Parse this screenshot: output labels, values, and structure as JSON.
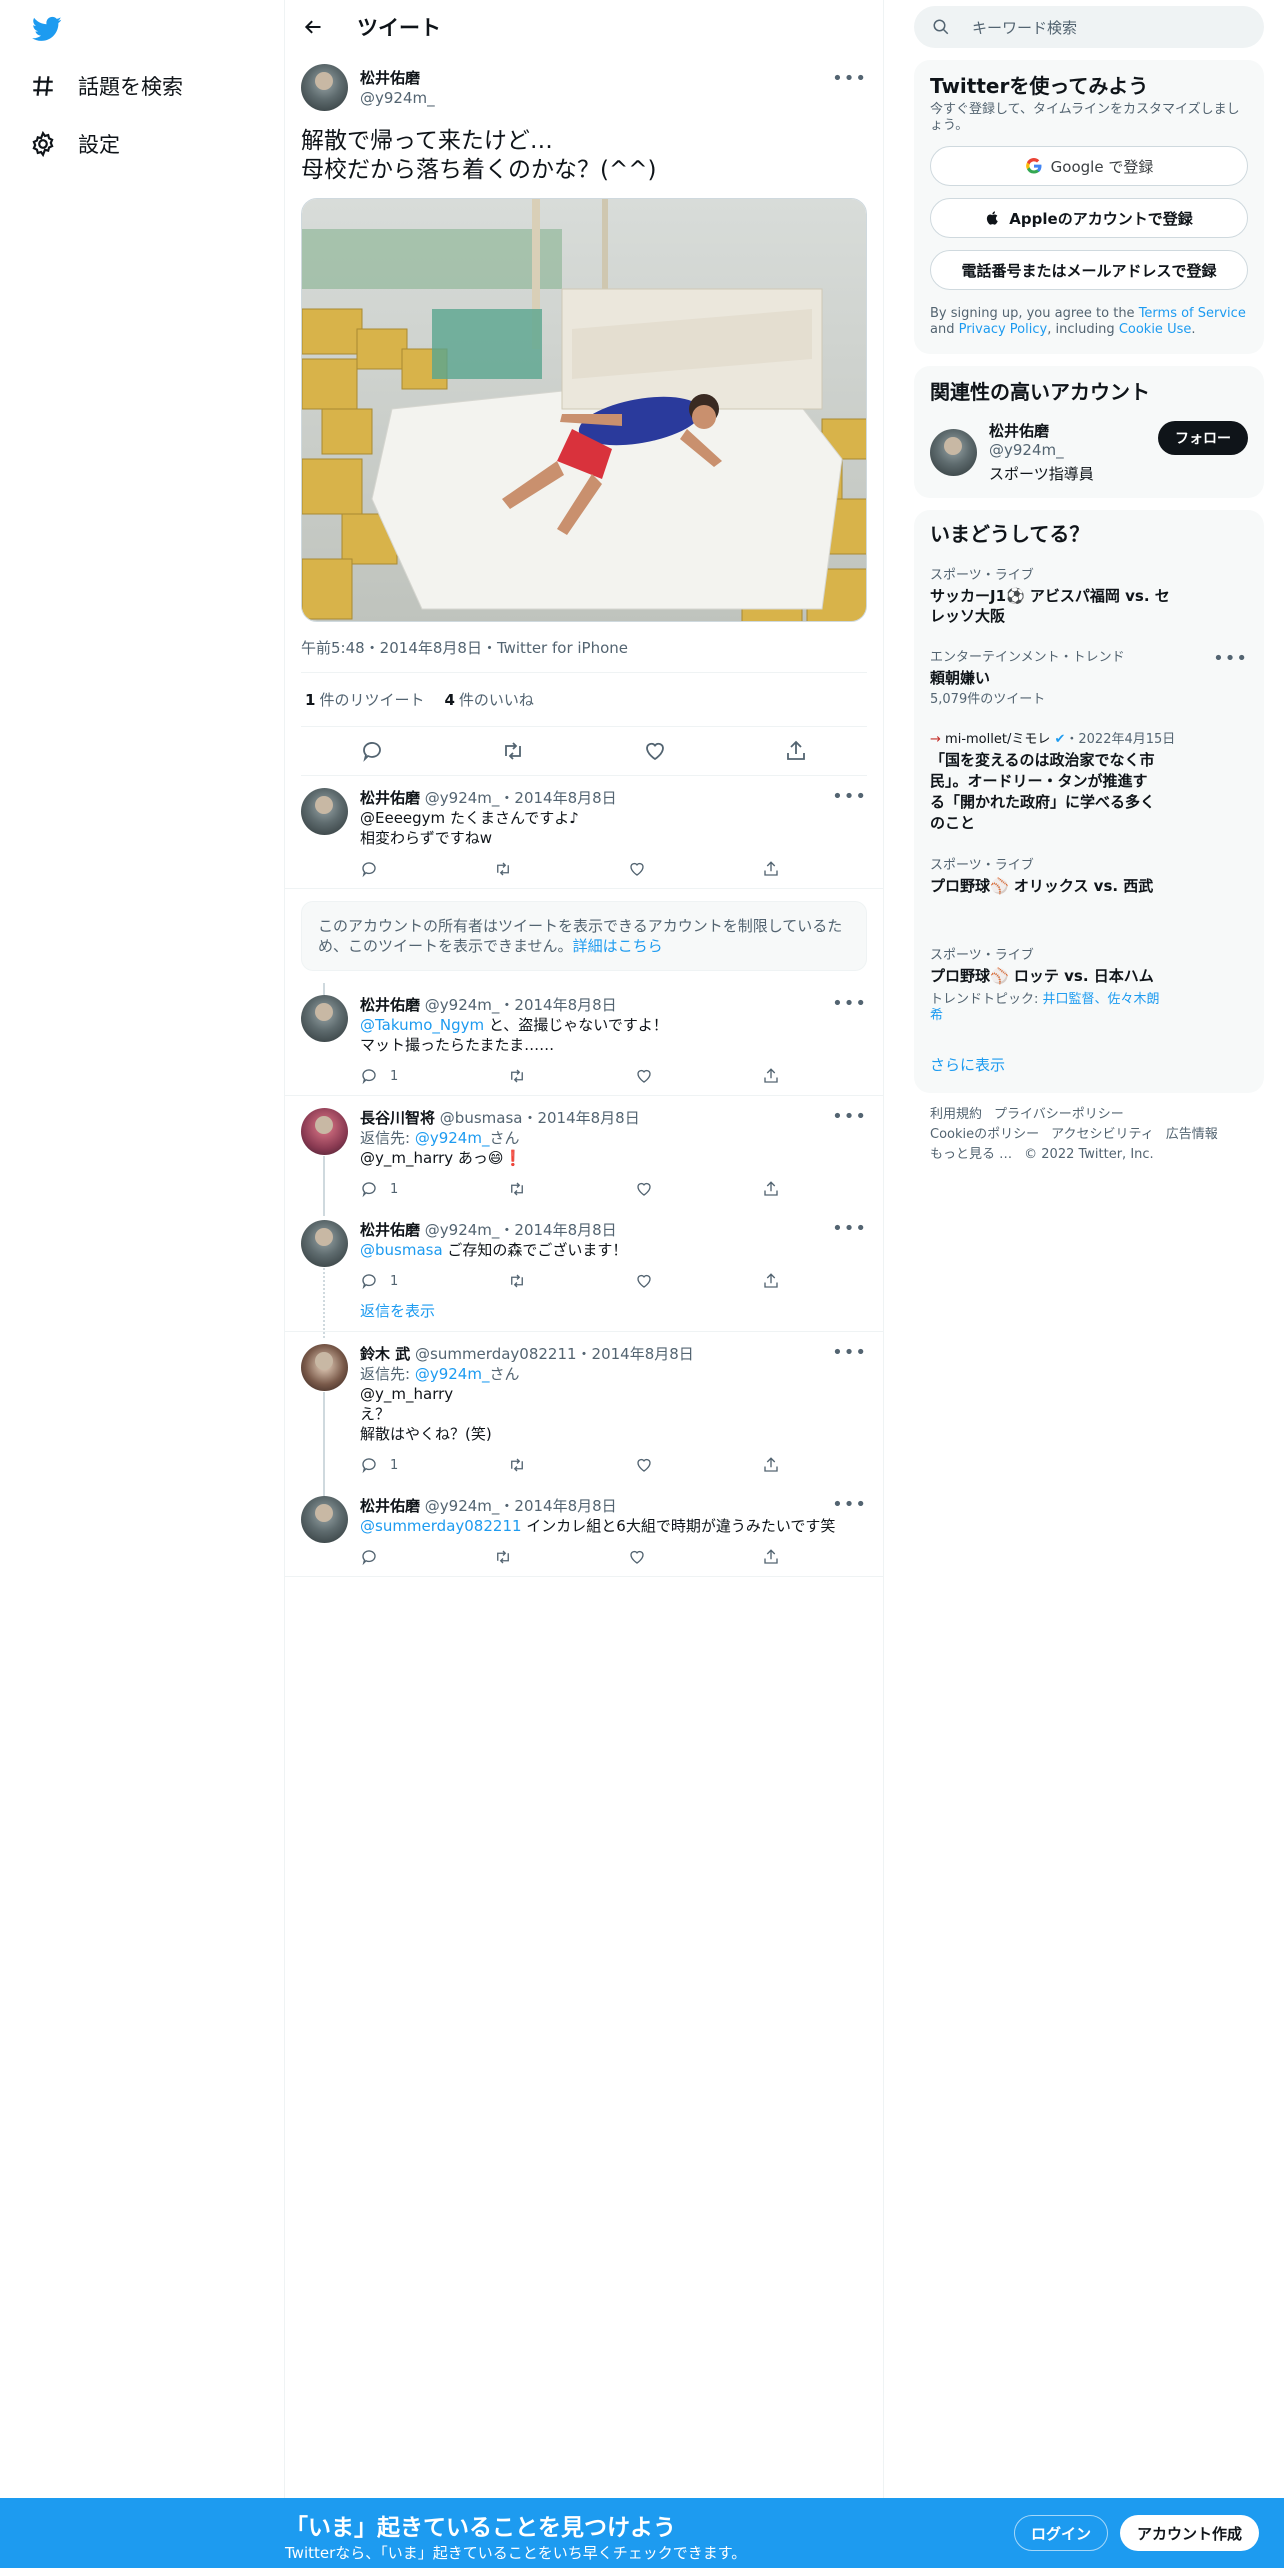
{
  "nav": {
    "explore": "話題を検索",
    "settings": "設定"
  },
  "header": {
    "title": "ツイート"
  },
  "focal": {
    "name": "松井佑磨",
    "handle": "@y924m_",
    "text": "解散で帰って来たけど…\n母校だから落ち着くのかな？(^^)",
    "meta": "午前5:48・2014年8月8日・Twitter for iPhone",
    "retweets_count": "1",
    "retweets_label": "件のリツイート",
    "likes_count": "4",
    "likes_label": "件のいいね"
  },
  "replies": [
    {
      "name": "松井佑磨",
      "handle": "@y924m_",
      "date": "・2014年8月8日",
      "text": "@Eeeegym たくまさんですよ♪\n相変わらずですねw",
      "count": ""
    },
    {
      "name": "松井佑磨",
      "handle": "@y924m_",
      "date": "・2014年8月8日",
      "mention": "@Takumo_Ngym",
      "text": " と、盗撮じゃないですよ！\nマット撮ったらたまたま……",
      "count": "1"
    },
    {
      "name": "長谷川智将",
      "handle": "@busmasa",
      "date": "・2014年8月8日",
      "reply_to_prefix": "返信先: ",
      "reply_to": "@y924m_",
      "reply_to_suffix": "さん",
      "text": "@y_m_harry あっ😄❗",
      "count": "1"
    },
    {
      "name": "松井佑磨",
      "handle": "@y924m_",
      "date": "・2014年8月8日",
      "mention": "@busmasa",
      "text": " ご存知の森でございます！",
      "count": "1"
    },
    {
      "name": "鈴木 武",
      "handle": "@summerday082211",
      "date": "・2014年8月8日",
      "reply_to_prefix": "返信先: ",
      "reply_to": "@y924m_",
      "reply_to_suffix": "さん",
      "text": "@y_m_harry\nえ？\n解散はやくね？(笑)",
      "count": "1"
    },
    {
      "name": "松井佑磨",
      "handle": "@y924m_",
      "date": "・2014年8月8日",
      "mention": "@summerday082211",
      "text": " インカレ組と6大組で時期が違うみたいです笑",
      "count": ""
    }
  ],
  "restricted": {
    "text": "このアカウントの所有者はツイートを表示できるアカウントを制限しているため、このツイートを表示できません。",
    "link": "詳細はこちら"
  },
  "show_replies": "返信を表示",
  "search": {
    "placeholder": "キーワード検索"
  },
  "signup": {
    "title": "Twitterを使ってみよう",
    "subtitle": "今すぐ登録して、タイムラインをカスタマイズしましょう。",
    "google": "Google で登録",
    "apple": "Appleのアカウントで登録",
    "phone": "電話番号またはメールアドレスで登録",
    "legal_1": "By signing up, you agree to the ",
    "tos": "Terms of Service",
    "legal_2": " and ",
    "privacy": "Privacy Policy",
    "legal_3": ", including ",
    "cookie": "Cookie Use",
    "legal_4": "."
  },
  "related": {
    "title": "関連性の高いアカウント",
    "name": "松井佑磨",
    "handle": "@y924m_",
    "bio": "スポーツ指導員",
    "follow": "フォロー"
  },
  "trends": {
    "title": "いまどうしてる？",
    "items": [
      {
        "category": "スポーツ・ライブ",
        "name": "サッカーJ1⚽️ アビスパ福岡 vs. セレッソ大阪"
      },
      {
        "category": "エンターテインメント・トレンド",
        "name": "頼朝嫌い",
        "count": "5,079件のツイート"
      },
      {
        "source": "mi-mollet/ミモレ",
        "date": "・2022年4月15日",
        "name": "「国を変えるのは政治家でなく市民」。オードリー・タンが推進する「開かれた政府」に学べる多くのこと"
      },
      {
        "category": "スポーツ・ライブ",
        "name": "プロ野球⚾ オリックス vs. 西武"
      },
      {
        "category": "スポーツ・ライブ",
        "name": "プロ野球⚾ ロッテ vs. 日本ハム",
        "topic_prefix": "トレンドトピック: ",
        "topic": "井口監督、佐々木朗希"
      }
    ],
    "more": "さらに表示"
  },
  "footer": {
    "links": [
      "利用規約",
      "プライバシーポリシー",
      "Cookieのポリシー",
      "アクセシビリティ",
      "広告情報",
      "もっと見る …"
    ],
    "copyright": "© 2022 Twitter, Inc."
  },
  "bottombar": {
    "title": "「いま」起きていることを見つけよう",
    "subtitle": "Twitterなら、「いま」起きていることをいち早くチェックできます。",
    "login": "ログイン",
    "signup": "アカウント作成"
  },
  "colors": {
    "accent": "#1d9bf0",
    "text": "#0f1419",
    "muted": "#536471"
  }
}
